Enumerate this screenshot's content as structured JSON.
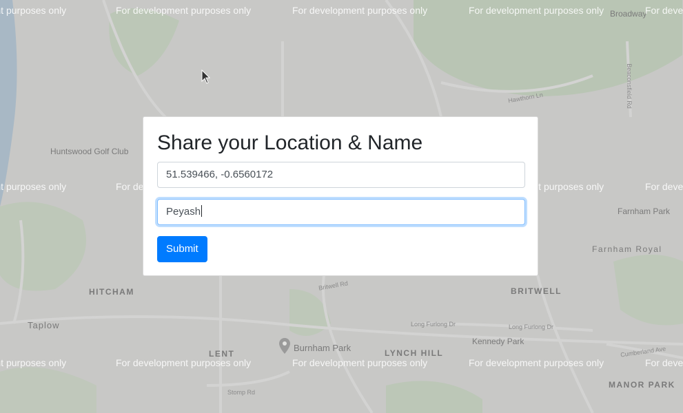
{
  "watermark_text": "For development purposes only",
  "map": {
    "places": [
      "Huntswood Golf Club",
      "HITCHAM",
      "Taplow",
      "LENT",
      "Burnham Park",
      "LYNCH HILL",
      "BRITWELL",
      "Kennedy Park",
      "Farnham Park",
      "Farnham Royal",
      "MANOR PARK",
      "Broadway"
    ],
    "roads": [
      "Hawthorn Ln",
      "Long Furlong Dr",
      "Cumberland Ave",
      "Stomp Rd",
      "Britwell Rd",
      "Beaconsfield Rd"
    ]
  },
  "form": {
    "title": "Share your Location & Name",
    "location_value": "51.539466, -0.6560172",
    "name_value": "Peyash",
    "submit_label": "Submit"
  },
  "colors": {
    "primary": "#007bff",
    "focus_border": "#80bdff",
    "title": "#212529"
  },
  "icons": [
    "mouse-pointer-icon",
    "map-pin-icon"
  ]
}
